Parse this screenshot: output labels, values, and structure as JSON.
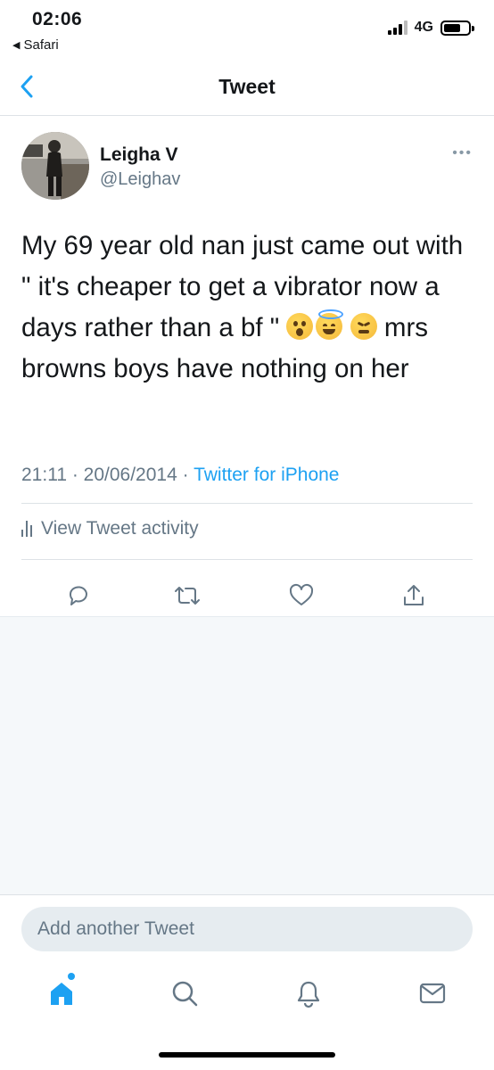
{
  "status_bar": {
    "time": "02:06",
    "back_app": "Safari",
    "network": "4G",
    "battery_level": 0.7
  },
  "nav": {
    "title": "Tweet",
    "back_icon": "chevron-left-icon"
  },
  "tweet": {
    "author_name": "Leigha V",
    "author_handle": "@Leighav",
    "more_icon": "more-horizontal-icon",
    "text_line1": "My 69 year old nan just came out with \" it's cheaper to get a vibrator now a days rather than a bf \"",
    "text_line2": "mrs browns boys have nothing on her",
    "emojis": [
      "astonished-face",
      "smiling-face-with-halo",
      "confounded-face"
    ],
    "time": "21:11",
    "date": "20/06/2014",
    "separator": " · ",
    "source": "Twitter for iPhone",
    "activity_label": "View Tweet activity"
  },
  "actions": {
    "reply_icon": "reply-icon",
    "retweet_icon": "retweet-icon",
    "like_icon": "heart-icon",
    "share_icon": "share-icon"
  },
  "compose": {
    "placeholder": "Add another Tweet"
  },
  "tabs": [
    "home-icon",
    "search-icon",
    "notifications-icon",
    "messages-icon"
  ],
  "colors": {
    "accent": "#1da1f2",
    "secondary_text": "#657786",
    "divider": "#dde2e6",
    "background_gray": "#f5f8fa"
  }
}
